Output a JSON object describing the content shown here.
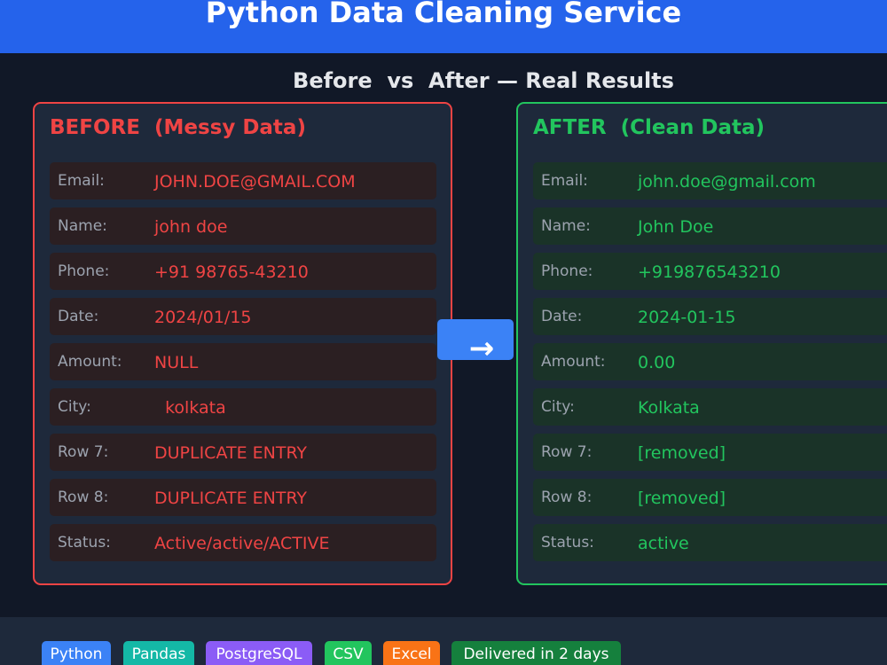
{
  "colors": {
    "header_bg": "#2563eb",
    "page_bg": "#111827",
    "panel_bg": "#1e293b",
    "before_accent": "#ef4444",
    "after_accent": "#22c55e",
    "arrow_bg": "#3b82f6"
  },
  "header": {
    "title": "Python Data Cleaning Service"
  },
  "subtitle": "Before  vs  After — Real Results",
  "before": {
    "title": "BEFORE  (Messy Data)",
    "rows": [
      {
        "label": "Email:",
        "value": "JOHN.DOE@GMAIL.COM"
      },
      {
        "label": "Name:",
        "value": "john doe"
      },
      {
        "label": "Phone:",
        "value": "+91 98765-43210"
      },
      {
        "label": "Date:",
        "value": "2024/01/15"
      },
      {
        "label": "Amount:",
        "value": "NULL"
      },
      {
        "label": "City:",
        "value": "  kolkata"
      },
      {
        "label": "Row 7:",
        "value": "DUPLICATE ENTRY"
      },
      {
        "label": "Row 8:",
        "value": "DUPLICATE ENTRY"
      },
      {
        "label": "Status:",
        "value": "Active/active/ACTIVE"
      }
    ]
  },
  "after": {
    "title": "AFTER  (Clean Data)",
    "rows": [
      {
        "label": "Email:",
        "value": "john.doe@gmail.com"
      },
      {
        "label": "Name:",
        "value": "John Doe"
      },
      {
        "label": "Phone:",
        "value": "+919876543210"
      },
      {
        "label": "Date:",
        "value": "2024-01-15"
      },
      {
        "label": "Amount:",
        "value": "0.00"
      },
      {
        "label": "City:",
        "value": "Kolkata"
      },
      {
        "label": "Row 7:",
        "value": "[removed]"
      },
      {
        "label": "Row 8:",
        "value": "[removed]"
      },
      {
        "label": "Status:",
        "value": "active"
      }
    ]
  },
  "arrow": {
    "icon": "right-arrow-icon",
    "glyph": "→"
  },
  "tags": [
    {
      "label": "Python",
      "color": "#3b82f6"
    },
    {
      "label": "Pandas",
      "color": "#14b8a6"
    },
    {
      "label": "PostgreSQL",
      "color": "#8b5cf6"
    },
    {
      "label": "CSV",
      "color": "#22c55e"
    },
    {
      "label": "Excel",
      "color": "#f97316"
    },
    {
      "label": "Delivered in 2 days",
      "color": "#15803d"
    }
  ]
}
